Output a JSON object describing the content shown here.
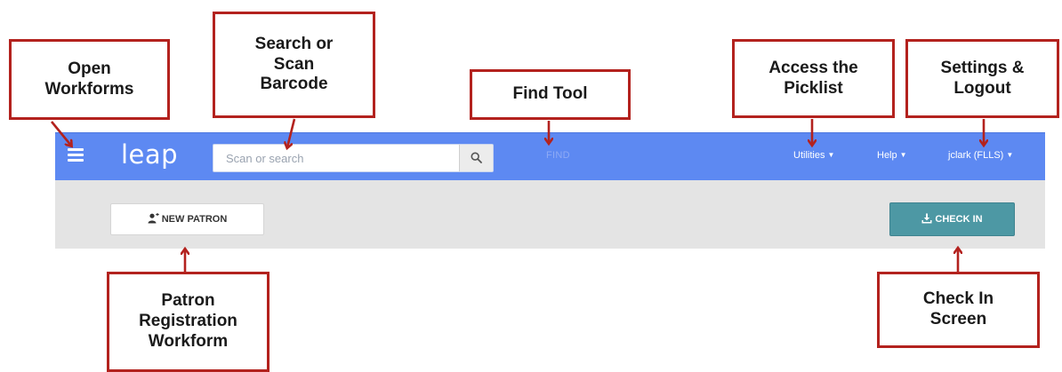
{
  "app": {
    "logo": "leap",
    "search": {
      "placeholder": "Scan or search"
    },
    "find_label": "FIND",
    "menus": {
      "utilities": "Utilities",
      "help": "Help",
      "user": "jclark (FLLS)"
    }
  },
  "toolbar": {
    "new_patron_label": "NEW PATRON",
    "check_in_label": "CHECK IN"
  },
  "callouts": {
    "open_workforms": "Open\nWorkforms",
    "search_scan": "Search or\nScan\nBarcode",
    "find_tool": "Find Tool",
    "picklist": "Access the\nPicklist",
    "settings": "Settings &\nLogout",
    "patron_reg": "Patron\nRegistration\nWorkform",
    "check_in_screen": "Check In\nScreen"
  },
  "colors": {
    "appbar": "#5d89f2",
    "toolbar": "#e4e4e4",
    "check_in_button": "#4d98a4",
    "callout_border": "#b3221e"
  },
  "icons": {
    "menu": "hamburger-icon",
    "search": "magnifier-icon",
    "new_patron": "user-plus-icon",
    "check_in": "download-tray-icon",
    "dropdown": "caret-down-icon"
  }
}
